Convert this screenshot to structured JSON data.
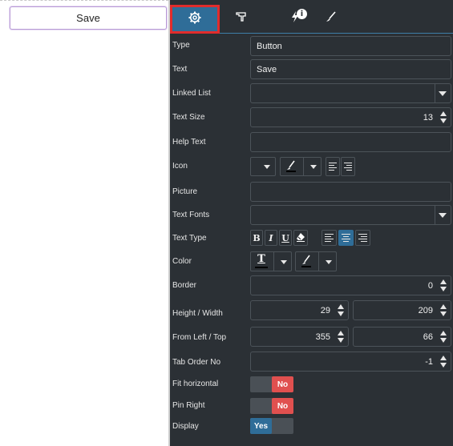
{
  "canvas": {
    "preview_button_label": "Save"
  },
  "tabs": [
    {
      "name": "settings",
      "active": true
    },
    {
      "name": "layout"
    },
    {
      "name": "events",
      "badge": "i"
    },
    {
      "name": "style"
    }
  ],
  "properties": {
    "type": {
      "label": "Type",
      "value": "Button"
    },
    "text": {
      "label": "Text",
      "value": "Save"
    },
    "linked_list": {
      "label": "Linked List",
      "value": ""
    },
    "text_size": {
      "label": "Text Size",
      "value": "13"
    },
    "help_text": {
      "label": "Help Text",
      "value": ""
    },
    "icon": {
      "label": "Icon"
    },
    "picture": {
      "label": "Picture",
      "value": ""
    },
    "text_fonts": {
      "label": "Text Fonts",
      "value": ""
    },
    "text_type": {
      "label": "Text Type",
      "bold": "B",
      "italic": "I",
      "underline": "U",
      "active_alignment": "center"
    },
    "color": {
      "label": "Color",
      "text_glyph": "T"
    },
    "border": {
      "label": "Border",
      "value": "0"
    },
    "height_width": {
      "label": "Height / Width",
      "height": "29",
      "width": "209"
    },
    "from_left_top": {
      "label": "From Left / Top",
      "left": "355",
      "top": "66"
    },
    "tab_order": {
      "label": "Tab Order No",
      "value": "-1"
    },
    "fit_horizontal": {
      "label": "Fit horizontal",
      "state": "No"
    },
    "pin_right": {
      "label": "Pin Right",
      "state": "No"
    },
    "display": {
      "label": "Display",
      "state": "Yes"
    }
  },
  "colors": {
    "panel_bg": "#2b3035",
    "accent": "#2f6d98",
    "toggle_no": "#e0504f",
    "highlight": "#e12c2c"
  }
}
